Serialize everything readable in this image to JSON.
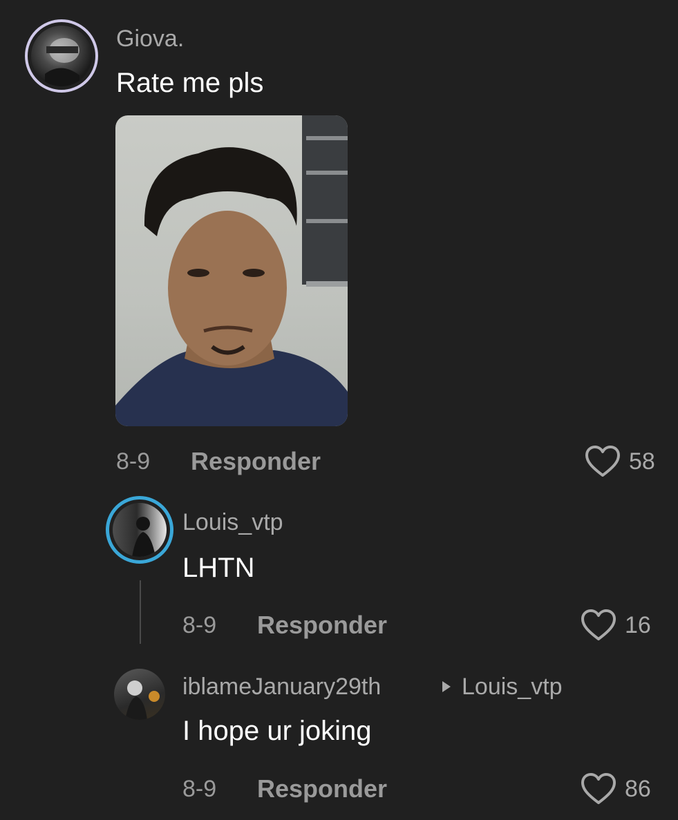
{
  "comments": [
    {
      "username": "Giova.",
      "text": "Rate me pls",
      "date": "8-9",
      "reply_label": "Responder",
      "likes": "58"
    },
    {
      "username": "Louis_vtp",
      "text": "LHTN",
      "date": "8-9",
      "reply_label": "Responder",
      "likes": "16"
    },
    {
      "username": "iblameJanuary29th",
      "reply_to": "Louis_vtp",
      "text": "I hope ur joking",
      "date": "8-9",
      "reply_label": "Responder",
      "likes": "86"
    }
  ],
  "colors": {
    "background": "#202020",
    "secondary_text": "#9a9a9a",
    "primary_text": "#ffffff"
  }
}
